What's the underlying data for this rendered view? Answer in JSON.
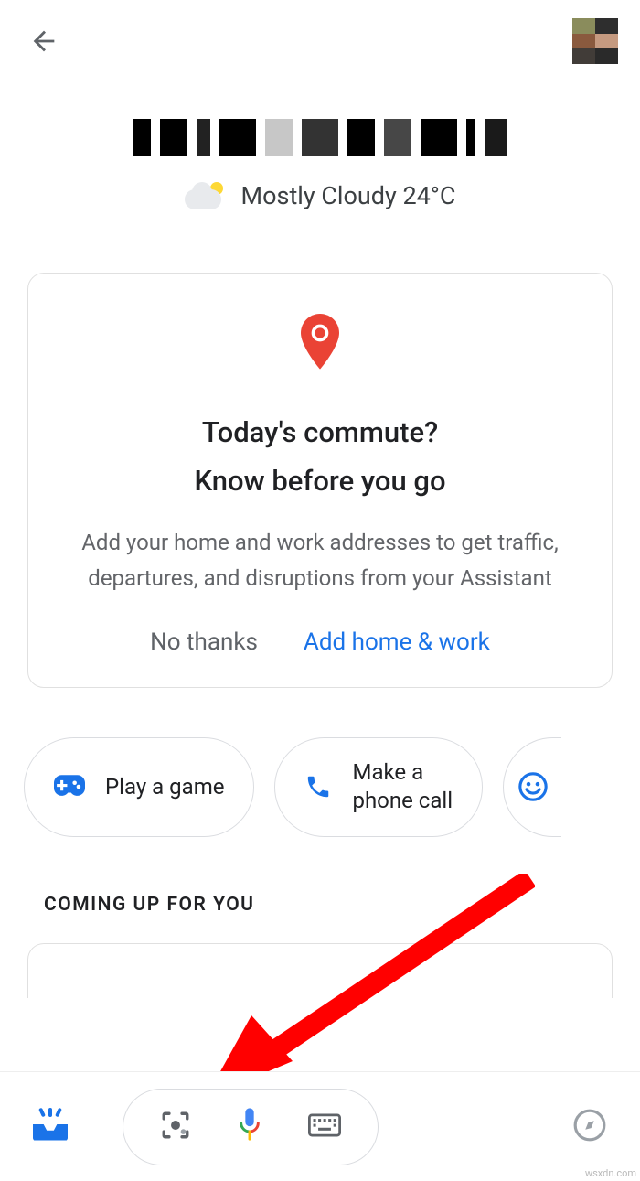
{
  "weather": {
    "text": "Mostly Cloudy 24°C"
  },
  "commute": {
    "title_l1": "Today's commute?",
    "title_l2": "Know before you go",
    "subtitle": "Add your home and work addresses to get traffic, departures, and disruptions from your Assistant",
    "no_thanks": "No thanks",
    "add": "Add home & work"
  },
  "chips": {
    "game": "Play a game",
    "call_l1": "Make a",
    "call_l2": "phone call"
  },
  "section": {
    "coming_up": "COMING UP FOR YOU"
  },
  "watermark": "wsxdn.com"
}
